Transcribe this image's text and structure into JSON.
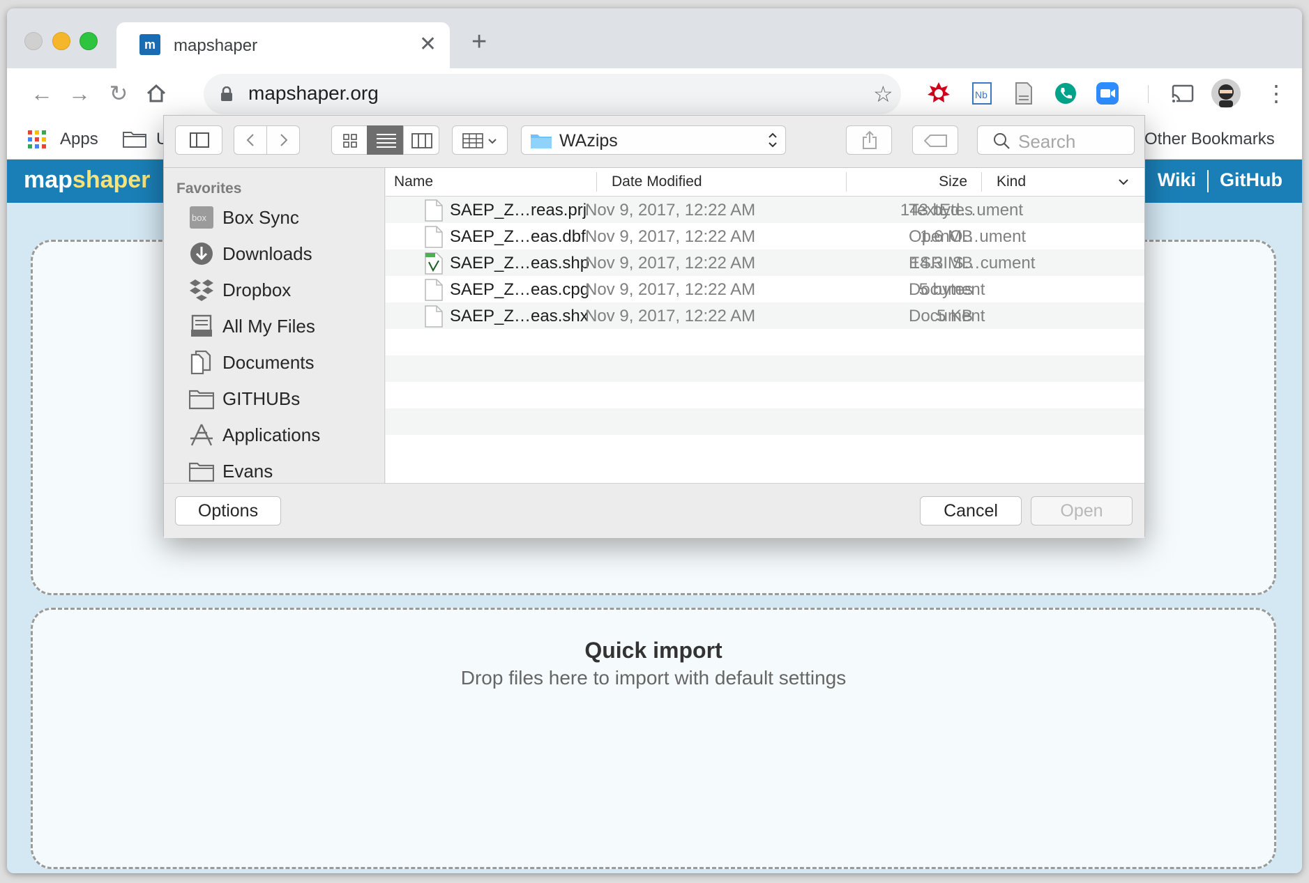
{
  "browser": {
    "tab_title": "mapshaper",
    "tab_favicon_text": "m",
    "url": "mapshaper.org",
    "bookmarks": {
      "apps_label": "Apps",
      "truncated_label": "U",
      "other_label": "Other Bookmarks"
    }
  },
  "app": {
    "logo_map": "map",
    "logo_shaper": "shaper",
    "links": [
      "Wiki",
      "GitHub"
    ],
    "quick_import": {
      "title": "Quick import",
      "subtitle": "Drop files here to import with default settings"
    }
  },
  "dialog": {
    "current_folder": "WAzips",
    "search_placeholder": "Search",
    "sidebar": {
      "heading": "Favorites",
      "items": [
        {
          "label": "Box Sync",
          "icon": "box-icon"
        },
        {
          "label": "Downloads",
          "icon": "downloads-icon"
        },
        {
          "label": "Dropbox",
          "icon": "dropbox-icon"
        },
        {
          "label": "All My Files",
          "icon": "all-files-icon"
        },
        {
          "label": "Documents",
          "icon": "documents-icon"
        },
        {
          "label": "GITHUBs",
          "icon": "folder-icon"
        },
        {
          "label": "Applications",
          "icon": "applications-icon"
        },
        {
          "label": "Evans",
          "icon": "folder-icon"
        }
      ]
    },
    "columns": {
      "name": "Name",
      "date": "Date Modified",
      "size": "Size",
      "kind": "Kind"
    },
    "files": [
      {
        "name": "SAEP_Z…reas.prj",
        "date": "Nov 9, 2017, 12:22 AM",
        "size": "143 bytes",
        "kind": "TextEd…ument"
      },
      {
        "name": "SAEP_Z…eas.dbf",
        "date": "Nov 9, 2017, 12:22 AM",
        "size": "1.6 MB",
        "kind": "OpenO…ument"
      },
      {
        "name": "SAEP_Z…eas.shp",
        "date": "Nov 9, 2017, 12:22 AM",
        "size": "14.3 MB",
        "kind": "ESRI S…cument"
      },
      {
        "name": "SAEP_Z…eas.cpg",
        "date": "Nov 9, 2017, 12:22 AM",
        "size": "5 bytes",
        "kind": "Document"
      },
      {
        "name": "SAEP_Z…eas.shx",
        "date": "Nov 9, 2017, 12:22 AM",
        "size": "5 KB",
        "kind": "Document"
      }
    ],
    "buttons": {
      "options": "Options",
      "cancel": "Cancel",
      "open": "Open"
    }
  }
}
